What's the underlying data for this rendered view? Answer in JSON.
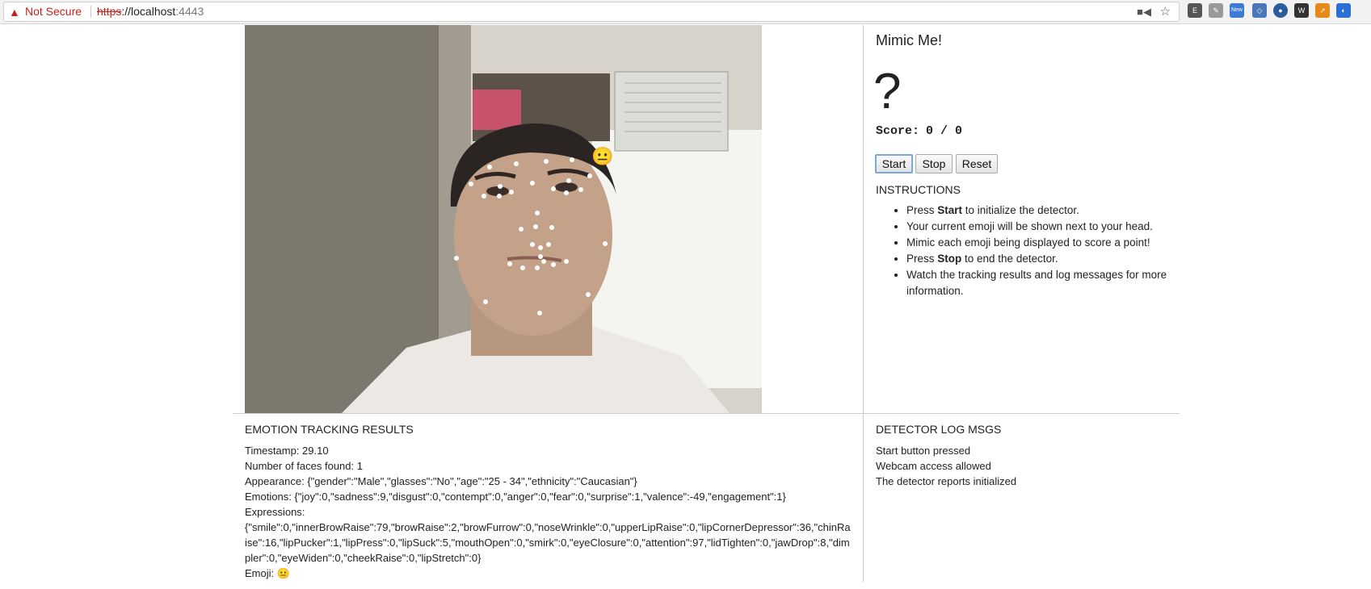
{
  "browser": {
    "security_label": "Not Secure",
    "url_scheme": "https",
    "url_separator": "://",
    "url_host": "localhost",
    "url_port": ":4443",
    "extension_badge": "New"
  },
  "app": {
    "title": "Mimic Me!",
    "current_emoji": "?",
    "score_label": "Score:",
    "score_value": "0 / 0",
    "buttons": {
      "start": "Start",
      "stop": "Stop",
      "reset": "Reset"
    },
    "instructions_title": "INSTRUCTIONS",
    "instructions": {
      "i1_pre": "Press ",
      "i1_bold": "Start",
      "i1_post": " to initialize the detector.",
      "i2": "Your current emoji will be shown next to your head.",
      "i3": "Mimic each emoji being displayed to score a point!",
      "i4_pre": "Press ",
      "i4_bold": "Stop",
      "i4_post": " to end the detector.",
      "i5": "Watch the tracking results and log messages for more information."
    }
  },
  "video": {
    "overlay_emoji": "😐"
  },
  "results": {
    "title": "EMOTION TRACKING RESULTS",
    "timestamp": "Timestamp: 29.10",
    "faces": "Number of faces found: 1",
    "appearance": "Appearance: {\"gender\":\"Male\",\"glasses\":\"No\",\"age\":\"25 - 34\",\"ethnicity\":\"Caucasian\"}",
    "emotions": "Emotions: {\"joy\":0,\"sadness\":9,\"disgust\":0,\"contempt\":0,\"anger\":0,\"fear\":0,\"surprise\":1,\"valence\":-49,\"engagement\":1}",
    "expressions_label": "Expressions:",
    "expressions": "{\"smile\":0,\"innerBrowRaise\":79,\"browRaise\":2,\"browFurrow\":0,\"noseWrinkle\":0,\"upperLipRaise\":0,\"lipCornerDepressor\":36,\"chinRaise\":16,\"lipPucker\":1,\"lipPress\":0,\"lipSuck\":5,\"mouthOpen\":0,\"smirk\":0,\"eyeClosure\":0,\"attention\":97,\"lidTighten\":0,\"jawDrop\":8,\"dimpler\":0,\"eyeWiden\":0,\"cheekRaise\":0,\"lipStretch\":0}",
    "emoji": "Emoji: 😐"
  },
  "log": {
    "title": "DETECTOR LOG MSGS",
    "messages": [
      "Start button pressed",
      "Webcam access allowed",
      "The detector reports initialized"
    ]
  },
  "colors": {
    "insecure_red": "#c5221f",
    "focus_blue": "#7aa7e0",
    "divider": "#cccccc"
  }
}
